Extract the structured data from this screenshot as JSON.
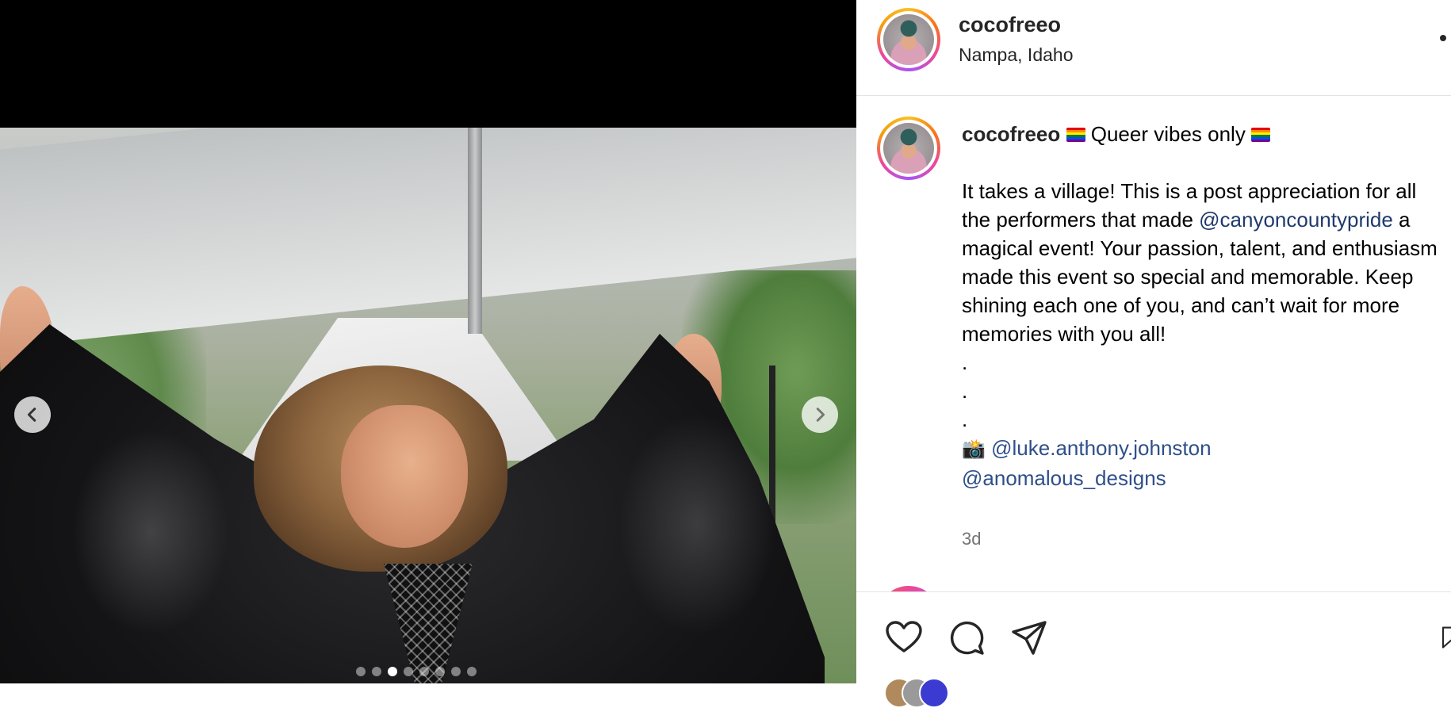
{
  "post": {
    "author": "cocofreeo",
    "location": "Nampa, Idaho",
    "caption_tagline": " Queer vibes only ",
    "caption_lines": [
      "It takes a village! This is a post appreciation for all the performers that made ",
      " a magical event! Your passion, talent, and enthusiasm made this event so special and memorable. Keep shining each one of you, and can’t wait for more memories with you all!"
    ],
    "mention_event": "@canyoncountypride",
    "dots": [
      ".",
      ".",
      "."
    ],
    "photo_credit_icon": "📸",
    "credit_mentions": [
      "@luke.anthony.johnston",
      "@anomalous_designs"
    ],
    "timestamp": "3d"
  },
  "carousel": {
    "slide_count": 8,
    "active_index": 2
  },
  "icons": {
    "prev": "chevron-left-icon",
    "next": "chevron-right-icon",
    "like": "heart-icon",
    "comment": "comment-icon",
    "share": "paper-plane-icon",
    "save": "bookmark-icon",
    "more": "more-options-icon"
  },
  "colors": {
    "mention": "#2f4f8a",
    "text": "#262626",
    "muted": "#737373"
  }
}
